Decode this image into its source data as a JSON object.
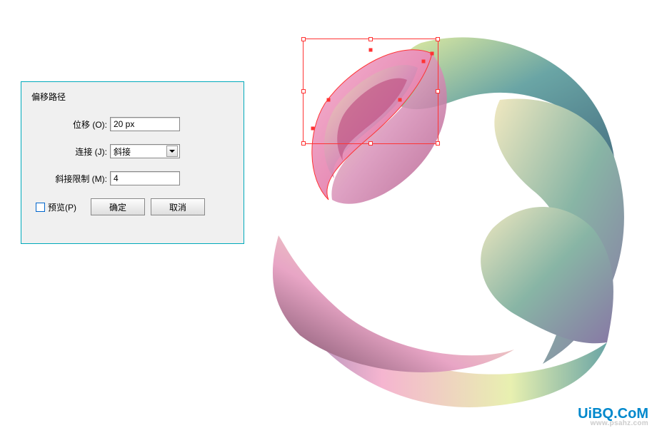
{
  "dialog": {
    "title": "偏移路径",
    "offset_label": "位移 (O):",
    "offset_value": "20 px",
    "join_label": "连接 (J):",
    "join_value": "斜接",
    "miter_label": "斜接限制 (M):",
    "miter_value": "4",
    "preview_label": "预览(P)",
    "ok_label": "确定",
    "cancel_label": "取消"
  },
  "watermark": {
    "text": "UiBQ.CoM",
    "sub": "www.psahz.com"
  }
}
